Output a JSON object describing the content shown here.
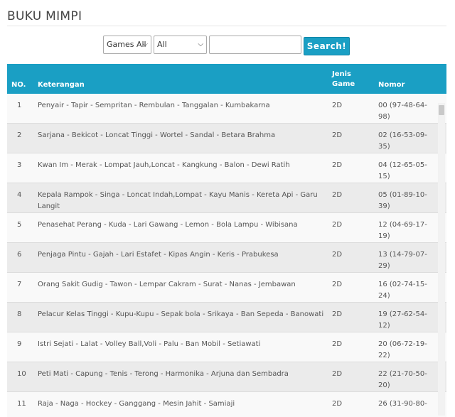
{
  "page": {
    "title": "BUKU MIMPI"
  },
  "search": {
    "game_select": {
      "value": "Games All"
    },
    "filter_select": {
      "value": "All"
    },
    "input": {
      "value": ""
    },
    "button_label": "Search!"
  },
  "table": {
    "headers": {
      "no": "NO.",
      "keterangan": "Keterangan",
      "jenis": "Jenis Game",
      "nomor": "Nomor"
    },
    "rows": [
      {
        "no": "1",
        "keterangan": "Penyair - Tapir - Sempritan - Rembulan - Tanggalan - Kumbakarna",
        "jenis": "2D",
        "nomor": "00 (97-48-64-98)"
      },
      {
        "no": "2",
        "keterangan": "Sarjana - Bekicot - Loncat Tinggi - Wortel - Sandal - Betara Brahma",
        "jenis": "2D",
        "nomor": "02 (16-53-09-35)"
      },
      {
        "no": "3",
        "keterangan": "Kwan Im - Merak - Lompat Jauh,Loncat - Kangkung - Balon - Dewi Ratih",
        "jenis": "2D",
        "nomor": "04 (12-65-05-15)"
      },
      {
        "no": "4",
        "keterangan": "Kepala Rampok - Singa - Loncat Indah,Lompat - Kayu Manis - Kereta Api - Garu Langit",
        "jenis": "2D",
        "nomor": "05 (01-89-10-39)"
      },
      {
        "no": "5",
        "keterangan": "Penasehat Perang - Kuda - Lari Gawang - Lemon - Bola Lampu - Wibisana",
        "jenis": "2D",
        "nomor": "12 (04-69-17-19)"
      },
      {
        "no": "6",
        "keterangan": "Penjaga Pintu - Gajah - Lari Estafet - Kipas Angin - Keris - Prabukesa",
        "jenis": "2D",
        "nomor": "13 (14-79-07-29)"
      },
      {
        "no": "7",
        "keterangan": "Orang Sakit Gudig - Tawon - Lempar Cakram - Surat - Nanas - Jembawan",
        "jenis": "2D",
        "nomor": "16 (02-74-15-24)"
      },
      {
        "no": "8",
        "keterangan": "Pelacur Kelas Tinggi - Kupu-Kupu - Sepak bola - Srikaya - Ban Sepeda - Banowati",
        "jenis": "2D",
        "nomor": "19 (27-62-54-12)"
      },
      {
        "no": "9",
        "keterangan": "Istri Sejati - Lalat - Volley Ball,Voli - Palu - Ban Mobil - Setiawati",
        "jenis": "2D",
        "nomor": "20 (06-72-19-22)"
      },
      {
        "no": "10",
        "keterangan": "Peti Mati - Capung - Tenis - Terong - Harmonika - Arjuna dan Sembadra",
        "jenis": "2D",
        "nomor": "22 (21-70-50-20)"
      },
      {
        "no": "11",
        "keterangan": "Raja - Naga - Hockey - Ganggang - Mesin Jahit - Samiaji",
        "jenis": "2D",
        "nomor": "26 (31-90-80-"
      }
    ]
  }
}
